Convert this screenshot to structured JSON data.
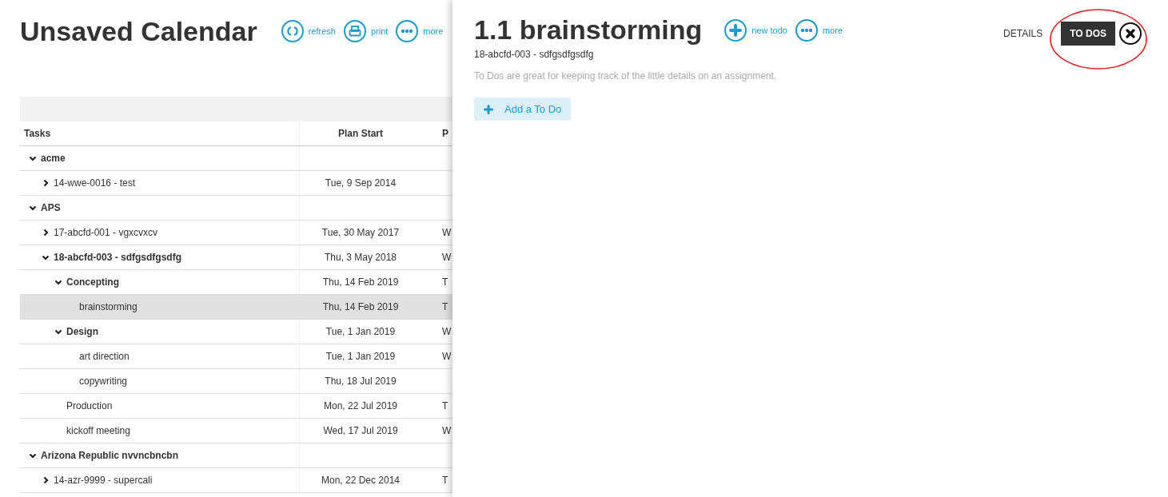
{
  "header": {
    "title": "Unsaved Calendar",
    "actions": [
      {
        "kind": "refresh",
        "label": "refresh"
      },
      {
        "kind": "print",
        "label": "print"
      },
      {
        "kind": "more",
        "label": "more"
      }
    ]
  },
  "table": {
    "columns": [
      "Tasks",
      "Plan Start",
      "P"
    ],
    "rows": [
      {
        "name": "acme",
        "expanded": true,
        "selected": false,
        "children": [
          {
            "name": "14-wwe-0016 - test",
            "plan_start": "Tue, 9 Sep 2014",
            "expanded": false,
            "selected": false
          }
        ]
      },
      {
        "name": "APS",
        "expanded": true,
        "selected": false,
        "children": [
          {
            "name": "17-abcfd-001 - vgxcvxcv",
            "plan_start": "Tue, 30 May 2017",
            "column_3": "W",
            "expanded": false,
            "selected": false
          },
          {
            "name": "18-abcfd-003 - sdfgsdfgsdfg",
            "plan_start": "Thu, 3 May 2018",
            "column_3": "W",
            "expanded": true,
            "selected": false,
            "children": [
              {
                "name": "Concepting",
                "plan_start": "Thu, 14 Feb 2019",
                "column_3": "T",
                "expanded": true,
                "selected": false,
                "children": [
                  {
                    "name": "brainstorming",
                    "plan_start": "Thu, 14 Feb 2019",
                    "column_3": "T",
                    "selected": true
                  }
                ]
              },
              {
                "name": "Design",
                "plan_start": "Tue, 1 Jan 2019",
                "column_3": "W",
                "expanded": true,
                "selected": false,
                "children": [
                  {
                    "name": "art direction",
                    "plan_start": "Tue, 1 Jan 2019",
                    "column_3": "W",
                    "selected": false
                  },
                  {
                    "name": "copywriting",
                    "plan_start": "Thu, 18 Jul 2019",
                    "selected": false
                  }
                ]
              },
              {
                "name": "Production",
                "plan_start": "Mon, 22 Jul 2019",
                "column_3": "T",
                "selected": false
              },
              {
                "name": "kickoff meeting",
                "plan_start": "Wed, 17 Jul 2019",
                "column_3": "W",
                "selected": false
              }
            ]
          }
        ]
      },
      {
        "name": "Arizona Republic nvvncbncbn",
        "expanded": true,
        "selected": false,
        "children": [
          {
            "name": "14-azr-9999 - supercali",
            "plan_start": "Mon, 22 Dec 2014",
            "column_3": "T",
            "expanded": false,
            "selected": false
          }
        ]
      }
    ]
  },
  "panel": {
    "title": "1.1 brainstorming",
    "subtitle": "18-abcfd-003 - sdfgsdfgsdfg",
    "actions": [
      {
        "kind": "add",
        "label": "new todo"
      },
      {
        "kind": "more",
        "label": "more"
      }
    ],
    "tabs": [
      {
        "label": "DETAILS",
        "selected": false
      },
      {
        "label": "TO DOS",
        "selected": true
      }
    ],
    "hint": "To Dos are great for keeping track of the little details on an assignment.",
    "add_button": "Add a To Do"
  }
}
